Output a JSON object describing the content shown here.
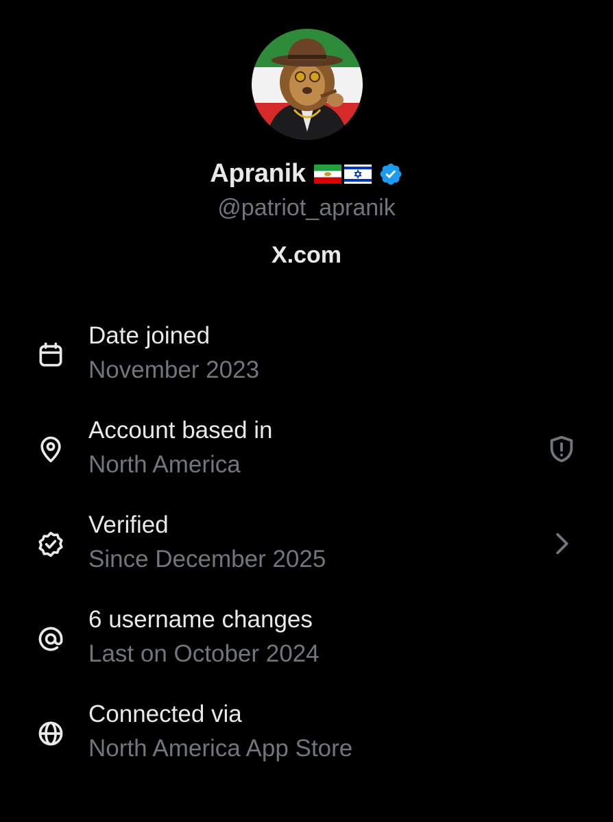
{
  "profile": {
    "display_name": "Apranik",
    "handle": "@patriot_apranik",
    "website": "X.com",
    "website_logo": "x-logo-icon",
    "flags": [
      "iran-lion-and-sun-flag",
      "israel-flag"
    ],
    "verified_badge_color": "#1d9bf0"
  },
  "details": [
    {
      "icon": "calendar-icon",
      "title": "Date joined",
      "subtitle": "November 2023"
    },
    {
      "icon": "location-pin-icon",
      "title": "Account based in",
      "subtitle": "North America",
      "trailing_icon": "shield-alert-icon"
    },
    {
      "icon": "verified-icon",
      "title": "Verified",
      "subtitle": "Since December 2025",
      "trailing_icon": "chevron-right-icon"
    },
    {
      "icon": "at-sign-icon",
      "title": "6 username changes",
      "subtitle": "Last on October 2024"
    },
    {
      "icon": "globe-icon",
      "title": "Connected via",
      "subtitle": "North America App Store"
    }
  ],
  "colors": {
    "background": "#000000",
    "primary_text": "#e7e9ea",
    "secondary_text": "#71767b",
    "accent": "#1d9bf0"
  }
}
